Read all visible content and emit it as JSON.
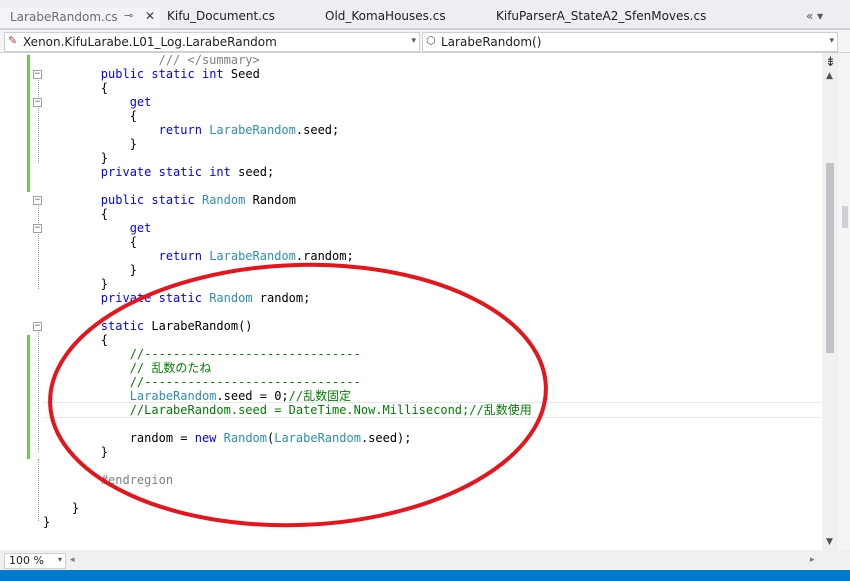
{
  "tabs": [
    {
      "label": "LarabeRandom.cs",
      "active": true
    },
    {
      "label": "Kifu_Document.cs"
    },
    {
      "label": "Old_KomaHouses.cs"
    },
    {
      "label": "KifuParserA_StateA2_SfenMoves.cs"
    }
  ],
  "tab_icons": {
    "pin": "⊸",
    "close": "✕",
    "overflow": "«  ▾"
  },
  "nav": {
    "namespace": "Xenon.KifuLarabe.L01_Log.LarabeRandom",
    "member": "LarabeRandom()",
    "dropdown": "▾"
  },
  "editor": {
    "lines": [
      {
        "t": "        /// </summary>"
      },
      {
        "t": "        public static int Seed"
      },
      {
        "t": "        {"
      },
      {
        "t": "            get"
      },
      {
        "t": "            {"
      },
      {
        "t": "                return LarabeRandom.seed;"
      },
      {
        "t": "            }"
      },
      {
        "t": "        }"
      },
      {
        "t": "        private static int seed;"
      },
      {
        "t": ""
      },
      {
        "t": "        public static Random Random"
      },
      {
        "t": "        {"
      },
      {
        "t": "            get"
      },
      {
        "t": "            {"
      },
      {
        "t": "                return LarabeRandom.random;"
      },
      {
        "t": "            }"
      },
      {
        "t": "        }"
      },
      {
        "t": "        private static Random random;"
      },
      {
        "t": ""
      },
      {
        "t": "        static LarabeRandom()"
      },
      {
        "t": "        {"
      },
      {
        "t": "            //------------------------------"
      },
      {
        "t": "            // 乱数のたね"
      },
      {
        "t": "            //------------------------------"
      },
      {
        "t": "            LarabeRandom.seed = 0;//乱数固定"
      },
      {
        "t": "            //LarabeRandom.seed = DateTime.Now.Millisecond;//乱数使用"
      },
      {
        "t": ""
      },
      {
        "t": "            random = new Random(LarabeRandom.seed);"
      },
      {
        "t": "        }"
      },
      {
        "t": ""
      },
      {
        "t": "        #endregion"
      },
      {
        "t": ""
      },
      {
        "t": "    }"
      },
      {
        "t": "}"
      }
    ]
  },
  "zoom": {
    "value": "100 %",
    "dropdown": "▾"
  },
  "scroll": {
    "up": "▲",
    "down": "▼",
    "left": "◂",
    "right": "▸",
    "splitter": "⇟"
  },
  "colors": {
    "annotation": "#e8141b",
    "keyword": "#0000ff",
    "type": "#2b91af",
    "comment": "#008000",
    "change_bar": "#6cca4c"
  }
}
